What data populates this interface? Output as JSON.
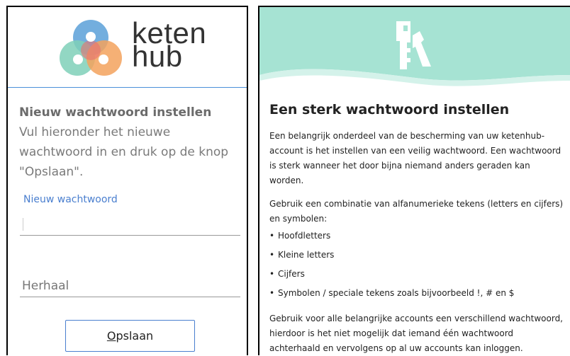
{
  "logo": {
    "line1": "keten",
    "line2": "hub"
  },
  "form": {
    "title": "Nieuw wachtwoord instellen",
    "description": "Vul hieronder het nieuwe wachtwoord in en druk op de knop \"Opslaan\".",
    "new_password_label": "Nieuw wachtwoord",
    "new_password_value": "",
    "repeat_placeholder": "Herhaal",
    "save_label_first": "O",
    "save_label_rest": "pslaan"
  },
  "info": {
    "title": "Een sterk wachtwoord instellen",
    "intro": "Een belangrijk onderdeel van de bescherming van uw ketenhub-account is het instellen van een veilig wachtwoord. Een wachtwoord is sterk wanneer het door bijna niemand anders geraden kan worden.",
    "combination": "Gebruik een combinatie van alfanumerieke tekens (letters en cijfers) en symbolen:",
    "bullets": [
      "Hoofdletters",
      "Kleine letters",
      "Cijfers",
      "Symbolen / speciale tekens zoals bijvoorbeeld !, # en $"
    ],
    "closing": "Gebruik voor alle belangrijke accounts een verschillend wachtwoord, hierdoor is het niet mogelijk dat iemand één wachtwoord achterhaald en vervolgens op al uw accounts kan inloggen."
  },
  "colors": {
    "accent_blue": "#4a7fcf",
    "banner_teal": "#a6e3d3",
    "logo_blue": "#5aa0d8",
    "logo_orange": "#f3a25d",
    "logo_green": "#7fd0b8",
    "logo_red": "#e9706f"
  },
  "icons": {
    "logo": "ketenhub-logo-icon",
    "banner": "keys-icon"
  }
}
